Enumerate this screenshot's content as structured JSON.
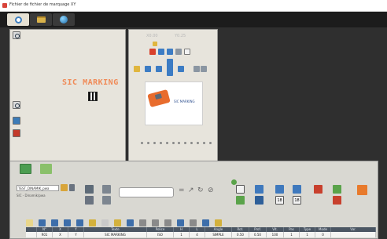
{
  "window": {
    "title": "Fichier de fichier de marquage XY"
  },
  "tabs": [
    {
      "name": "settings-tab",
      "icon": "gear-icon",
      "active": true
    },
    {
      "name": "folder-tab",
      "icon": "folder-icon",
      "active": false
    },
    {
      "name": "globe-tab",
      "icon": "globe-icon",
      "active": false
    }
  ],
  "left_panel": {
    "marking_title": "SIC MARKING"
  },
  "mid_panel": {
    "x_label": "X0.00",
    "y_label": "Y0.25",
    "preview_caption": "SIC MARKING"
  },
  "bottom_panel": {
    "file_field": "TEST_DINAMIK_pwa",
    "file_sub": "SIC - Dinamik/pwa",
    "font_size_value": "18",
    "font_size_value_2": "18",
    "table": {
      "headers": [
        "",
        "N°",
        "X",
        "Y",
        "Texte",
        "Police",
        "H",
        "L",
        "Angle",
        "Rot.",
        "Prof.",
        "Vit.",
        "Pas",
        "Type",
        "Mode",
        "Var."
      ],
      "row": [
        "",
        "R01",
        "X",
        "Y",
        "SIC MARKING",
        "ISO",
        "1",
        "4",
        "SIMPLE",
        "0.50",
        "0.50",
        "100",
        "1",
        "1",
        "0",
        ""
      ]
    }
  },
  "colors": {
    "accent": "#f08a57",
    "panel": "#e7e4dc",
    "toolbar": "#d9d8d2"
  }
}
